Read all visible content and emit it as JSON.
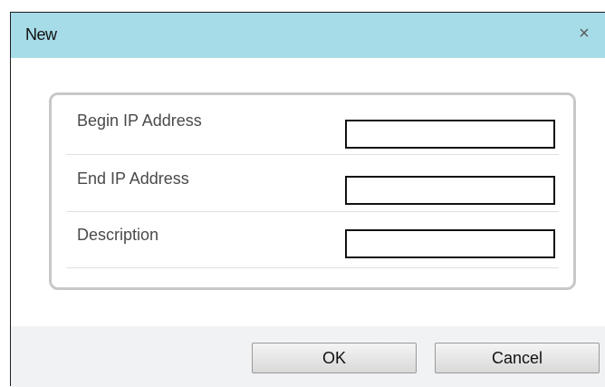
{
  "dialog": {
    "title": "New",
    "close_glyph": "×",
    "close_icon": "close-icon"
  },
  "form": {
    "rows": [
      {
        "label": "Begin IP Address",
        "value": ""
      },
      {
        "label": "End IP Address",
        "value": ""
      },
      {
        "label": "Description",
        "value": ""
      }
    ]
  },
  "footer": {
    "ok_label": "OK",
    "cancel_label": "Cancel"
  },
  "colors": {
    "titlebar": "#a6dbe8",
    "footer": "#f1f2f4",
    "panel_border": "#c8c8c8"
  }
}
